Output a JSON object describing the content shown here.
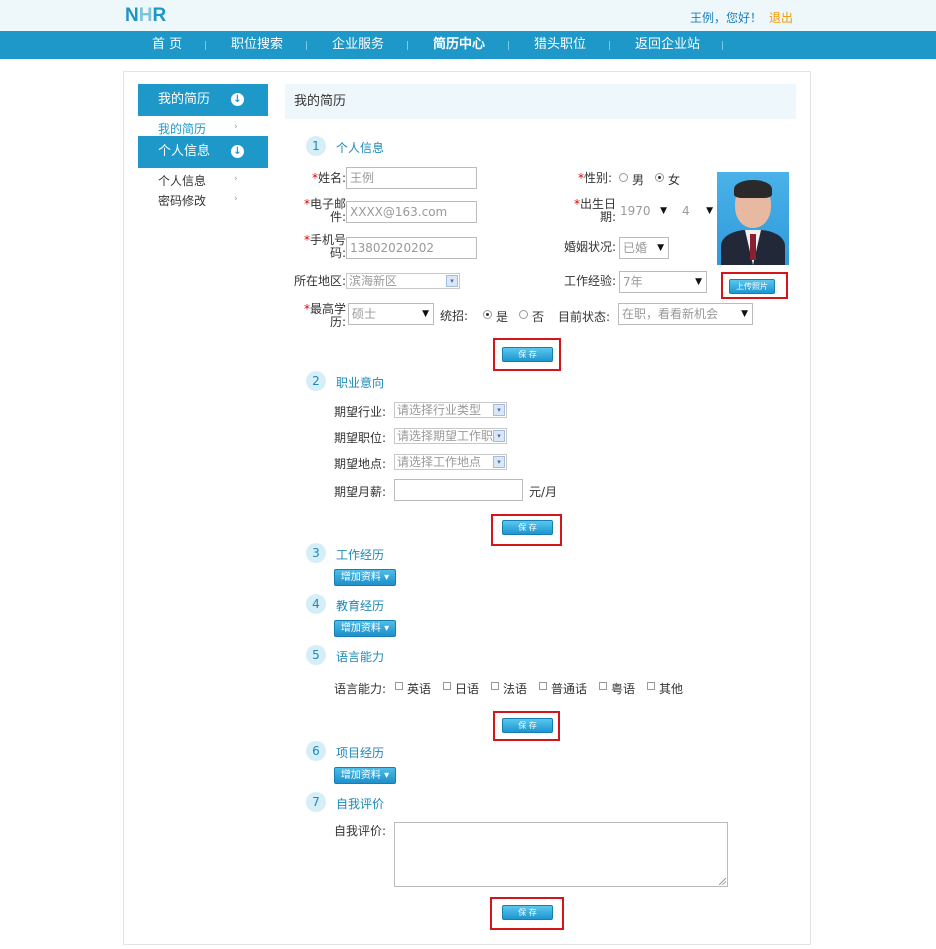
{
  "header": {
    "logo_left": "N",
    "logo_mid": "H",
    "logo_right": "R",
    "greeting": "王例，您好！",
    "logout": "退出"
  },
  "nav": [
    "首 页",
    "职位搜索",
    "企业服务",
    "简历中心",
    "猎头职位",
    "返回企业站"
  ],
  "sidebar": {
    "group1": "我的简历",
    "group1_items": [
      "我的简历"
    ],
    "group2": "个人信息",
    "group2_items": [
      "个人信息",
      "密码修改"
    ]
  },
  "page_title": "我的简历",
  "sections": [
    {
      "num": "1",
      "title": "个人信息"
    },
    {
      "num": "2",
      "title": "职业意向"
    },
    {
      "num": "3",
      "title": "工作经历"
    },
    {
      "num": "4",
      "title": "教育经历"
    },
    {
      "num": "5",
      "title": "语言能力"
    },
    {
      "num": "6",
      "title": "项目经历"
    },
    {
      "num": "7",
      "title": "自我评价"
    }
  ],
  "personal": {
    "name_label": "姓名:",
    "name_value": "王例",
    "gender_label": "性别:",
    "gender_male": "男",
    "gender_female": "女",
    "gender_selected": "女",
    "email_label_1": "电子邮",
    "email_label_2": "件:",
    "email_value": "XXXX@163.com",
    "birth_label_1": "出生日",
    "birth_label_2": "期:",
    "birth_year": "1970",
    "birth_month": "4",
    "phone_label_1": "手机号",
    "phone_label_2": "码:",
    "phone_value": "13802020202",
    "marital_label": "婚姻状况:",
    "marital_value": "已婚",
    "region_label": "所在地区:",
    "region_value": "滨海新区",
    "experience_label": "工作经验:",
    "experience_value": "7年",
    "upload_photo": "上传照片",
    "edu_label_1": "最高学",
    "edu_label_2": "历:",
    "edu_value": "硕士",
    "unified_label": "统招:",
    "unified_yes": "是",
    "unified_no": "否",
    "unified_selected": "是",
    "status_label": "目前状态:",
    "status_value": "在职，看看新机会",
    "required_mark": "*"
  },
  "intention": {
    "industry_label": "期望行业:",
    "industry_placeholder": "请选择行业类型",
    "position_label": "期望职位:",
    "position_placeholder": "请选择期望工作职",
    "location_label": "期望地点:",
    "location_placeholder": "请选择工作地点",
    "salary_label": "期望月薪:",
    "salary_value": "",
    "salary_unit": "元/月"
  },
  "add_button": "增加资料 ▾",
  "save_button": "保 存",
  "language": {
    "label": "语言能力:",
    "options": [
      "英语",
      "日语",
      "法语",
      "普通话",
      "粤语",
      "其他"
    ]
  },
  "self_eval": {
    "label": "自我评价:",
    "value": ""
  },
  "colors": {
    "brand": "#1e98c8",
    "highlight_box": "#d4161b",
    "logout": "#f39a00"
  }
}
